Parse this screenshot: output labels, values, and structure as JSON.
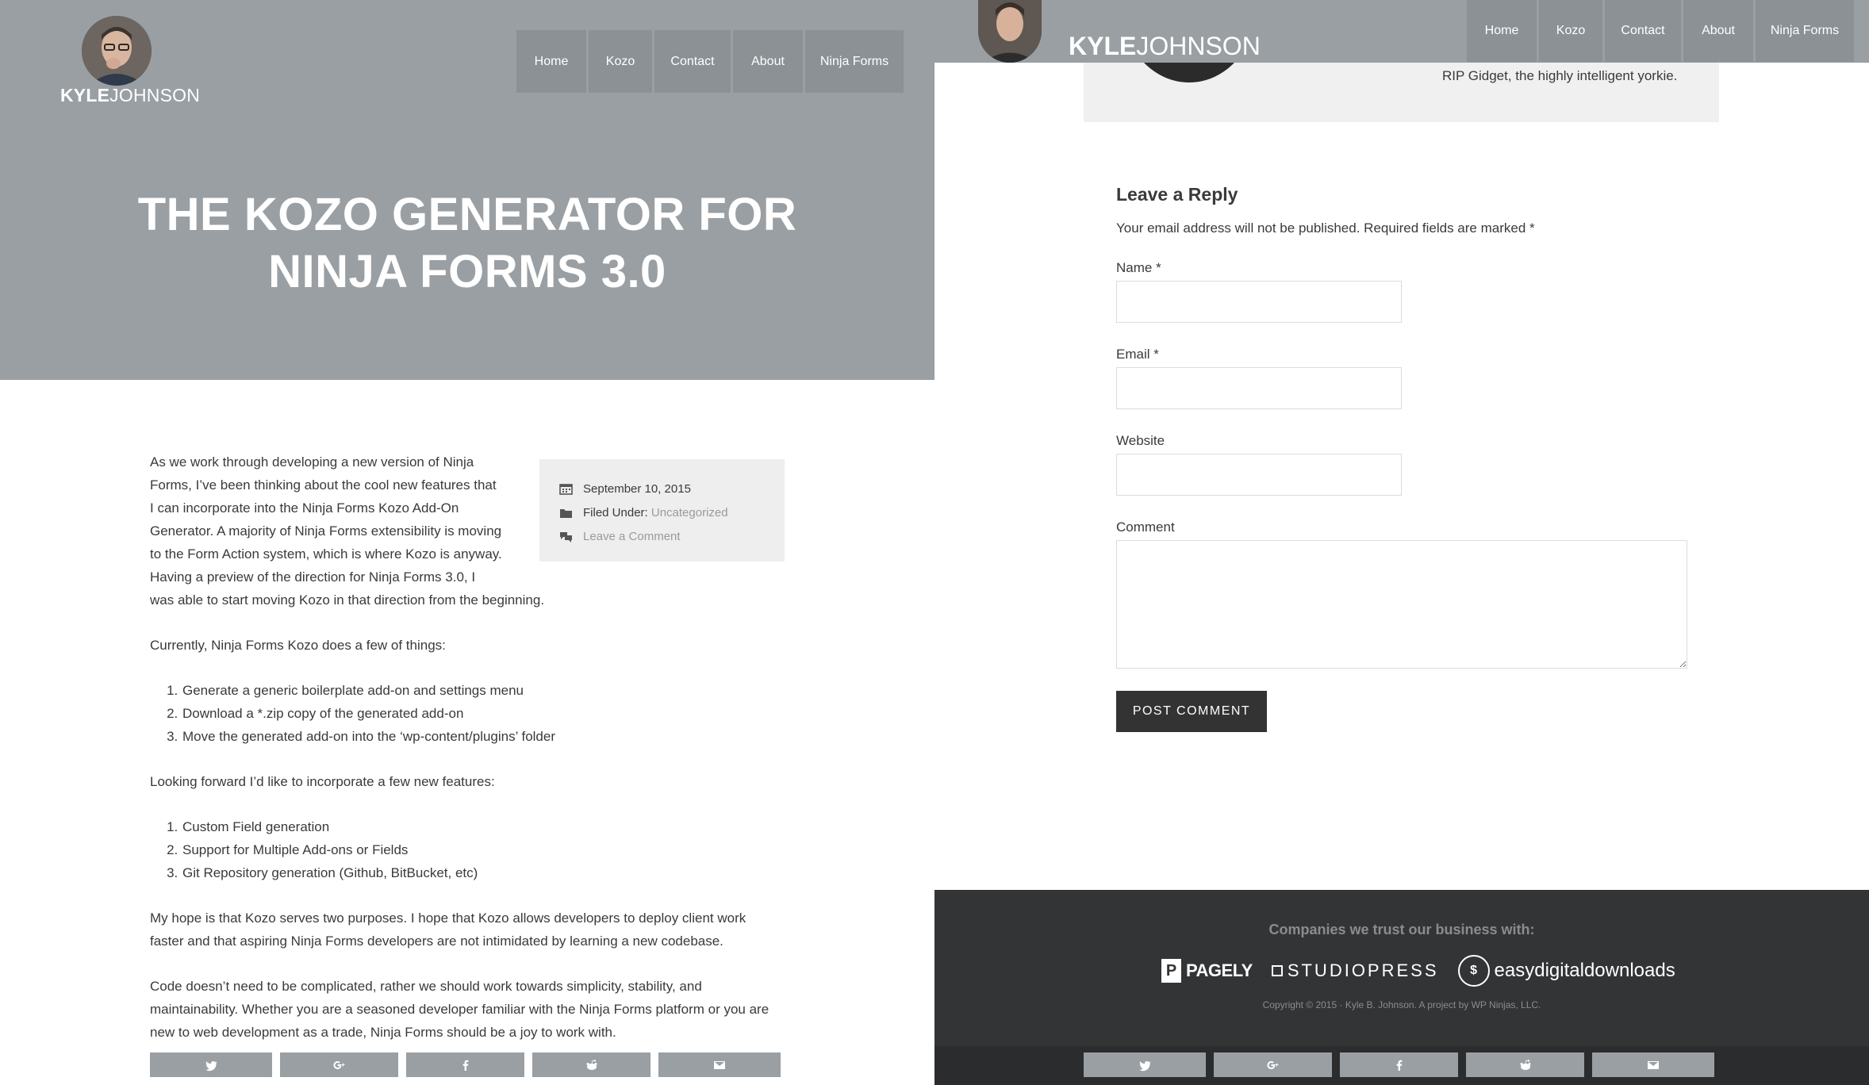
{
  "left": {
    "logo": {
      "first": "KYLE",
      "last": "JOHNSON"
    },
    "nav": [
      {
        "label": "Home"
      },
      {
        "label": "Kozo"
      },
      {
        "label": "Contact"
      },
      {
        "label": "About"
      },
      {
        "label": "Ninja Forms"
      }
    ],
    "title_line1": "THE KOZO GENERATOR FOR",
    "title_line2": "NINJA FORMS 3.0",
    "meta": {
      "date": "September 10, 2015",
      "filed_label": "Filed Under:",
      "filed_value": "Uncategorized",
      "comment_link": "Leave a Comment"
    },
    "intro_lines": [
      "As we work through developing a new version of Ninja",
      "Forms, I’ve been thinking about the cool new features that",
      "I can incorporate into the Ninja Forms Kozo Add-On",
      "Generator. A majority of Ninja Forms extensibility is moving",
      "to the Form Action system, which is where Kozo is anyway.",
      "Having a preview of the direction for Ninja Forms 3.0, I",
      "was able to start moving Kozo in that direction from the beginning."
    ],
    "para_current": "Currently, Ninja Forms Kozo does a few of things:",
    "list_current": [
      "Generate a generic boilerplate add-on and settings menu",
      "Download a *.zip copy of the generated add-on",
      "Move the generated add-on into the ‘wp-content/plugins’ folder"
    ],
    "para_forward": "Looking forward I’d like to incorporate a few new features:",
    "list_forward": [
      "Custom Field generation",
      "Support for Multiple Add-ons or Fields",
      "Git Repository generation (Github, BitBucket, etc)"
    ],
    "para_hope": "My hope is that Kozo serves two purposes. I hope that Kozo allows developers to deploy client work faster and that aspiring Ninja Forms developers are not intimidated by learning a new codebase.",
    "para_code": "Code doesn’t need to be complicated, rather we should work towards simplicity, stability, and maintainability. Whether you are a seasoned developer familiar with the Ninja Forms platform or you are new to web development as a trade, Ninja Forms should be a joy to work with.",
    "share_icons": [
      "twitter-icon",
      "google-plus-icon",
      "facebook-icon",
      "reddit-icon",
      "email-icon"
    ]
  },
  "right": {
    "logo": {
      "first": "KYLE",
      "last": "JOHNSON"
    },
    "nav": [
      {
        "label": "Home"
      },
      {
        "label": "Kozo"
      },
      {
        "label": "Contact"
      },
      {
        "label": "About"
      },
      {
        "label": "Ninja Forms"
      }
    ],
    "author_bio": "RIP Gidget, the highly intelligent yorkie.",
    "reply": {
      "heading": "Leave a Reply",
      "note": "Your email address will not be published. Required fields are marked *",
      "name_label": "Name *",
      "name_value": "",
      "email_label": "Email *",
      "email_value": "",
      "website_label": "Website",
      "website_value": "",
      "comment_label": "Comment",
      "comment_value": "",
      "submit_label": "POST COMMENT"
    },
    "footer": {
      "heading": "Companies we trust our business with:",
      "partners": {
        "pagely_mark": "P",
        "pagely": "PAGELY",
        "studiopress": "STUDIOPRESS",
        "edd_mark": "$",
        "edd_prefix": "easy",
        "edd_middle": "digital",
        "edd_suffix": "downloads"
      },
      "copyright": "Copyright © 2015 · Kyle B. Johnson. A project by WP Ninjas, LLC."
    },
    "share_icons": [
      "twitter-icon",
      "google-plus-icon",
      "facebook-icon",
      "reddit-icon",
      "email-icon"
    ]
  },
  "colors": {
    "hero_bg": "#9a9fa3",
    "nav_bg": "#8c9195",
    "footer_bg": "#333436",
    "button_dark": "#333333",
    "meta_box_bg": "#eeeeee"
  }
}
